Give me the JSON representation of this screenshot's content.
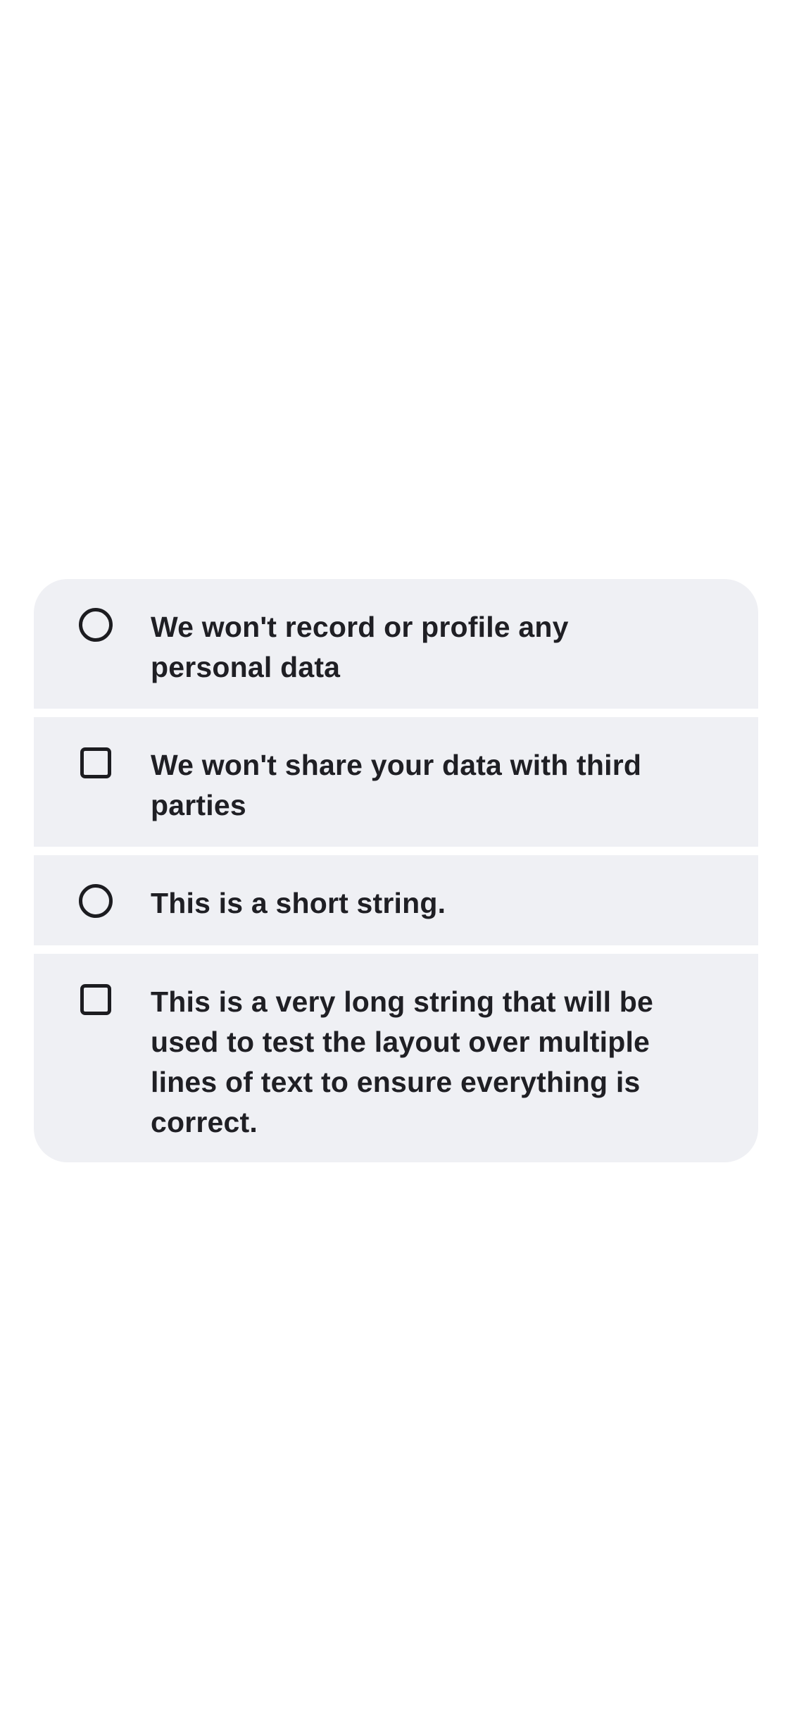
{
  "options": [
    {
      "label": "We won't record or profile any personal data",
      "control": "radio",
      "icon": "circle-outline-icon"
    },
    {
      "label": "We won't share your data with third parties",
      "control": "checkbox",
      "icon": "square-outline-icon"
    },
    {
      "label": "This is a short string.",
      "control": "radio",
      "icon": "circle-outline-icon"
    },
    {
      "label": "This is a very long string that will be used to test the layout over multiple lines of text to ensure everything is correct.",
      "control": "checkbox",
      "icon": "square-outline-icon"
    }
  ],
  "colors": {
    "card_background": "#eff0f4",
    "text": "#1f1f24",
    "icon_stroke": "#1c1c20",
    "page_background": "#ffffff"
  }
}
